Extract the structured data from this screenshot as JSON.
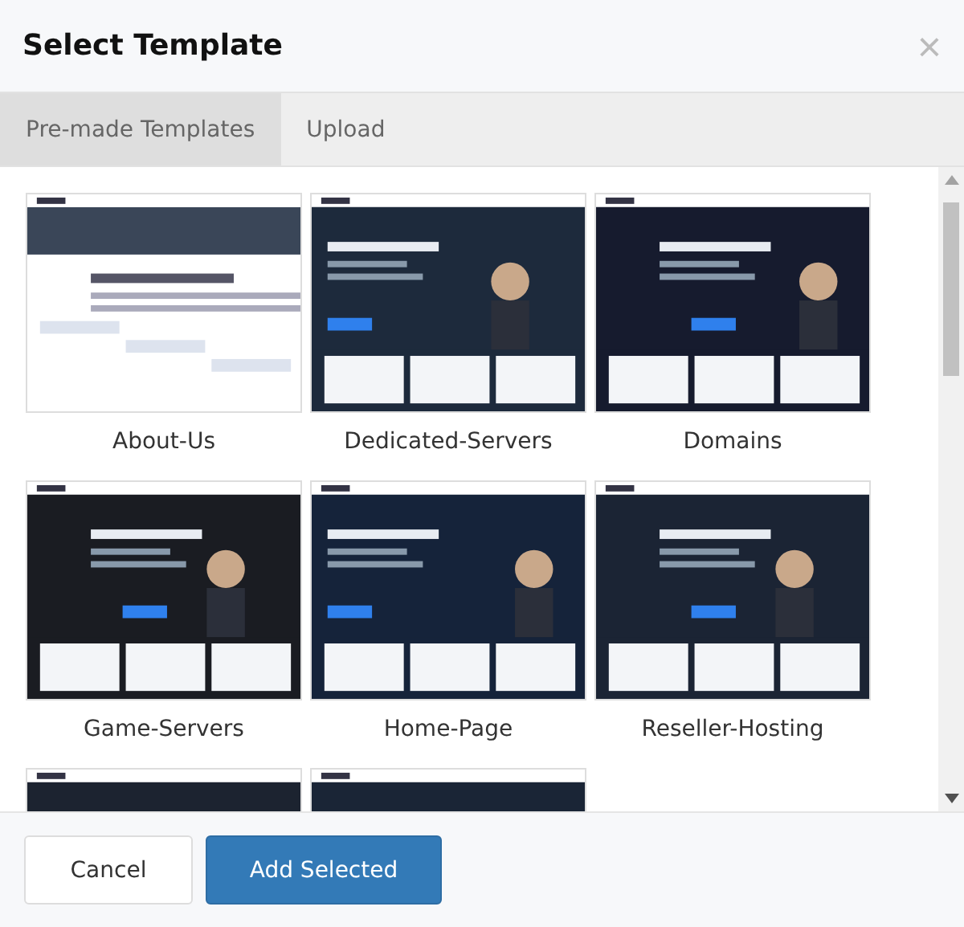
{
  "dialog": {
    "title": "Select Template",
    "close": "×"
  },
  "tabs": [
    {
      "label": "Pre-made Templates",
      "selected": true
    },
    {
      "label": "Upload",
      "selected": false
    }
  ],
  "templates": [
    {
      "name": "About-Us",
      "preview": {
        "kind": "picture"
      }
    },
    {
      "name": "Dedicated-Servers",
      "preview": {
        "kind": "picture"
      }
    },
    {
      "name": "Domains",
      "preview": {
        "kind": "picture"
      }
    },
    {
      "name": "Game-Servers",
      "preview": {
        "kind": "picture"
      }
    },
    {
      "name": "Home-Page",
      "preview": {
        "kind": "picture"
      }
    },
    {
      "name": "Reseller-Hosting",
      "preview": {
        "kind": "picture"
      }
    },
    {
      "preview": {
        "kind": "picture"
      }
    },
    {
      "preview": {
        "kind": "picture"
      }
    }
  ],
  "buttons": [
    {
      "label": "Cancel",
      "kind": "secondary"
    },
    {
      "label": "Add Selected",
      "kind": "primary"
    }
  ]
}
